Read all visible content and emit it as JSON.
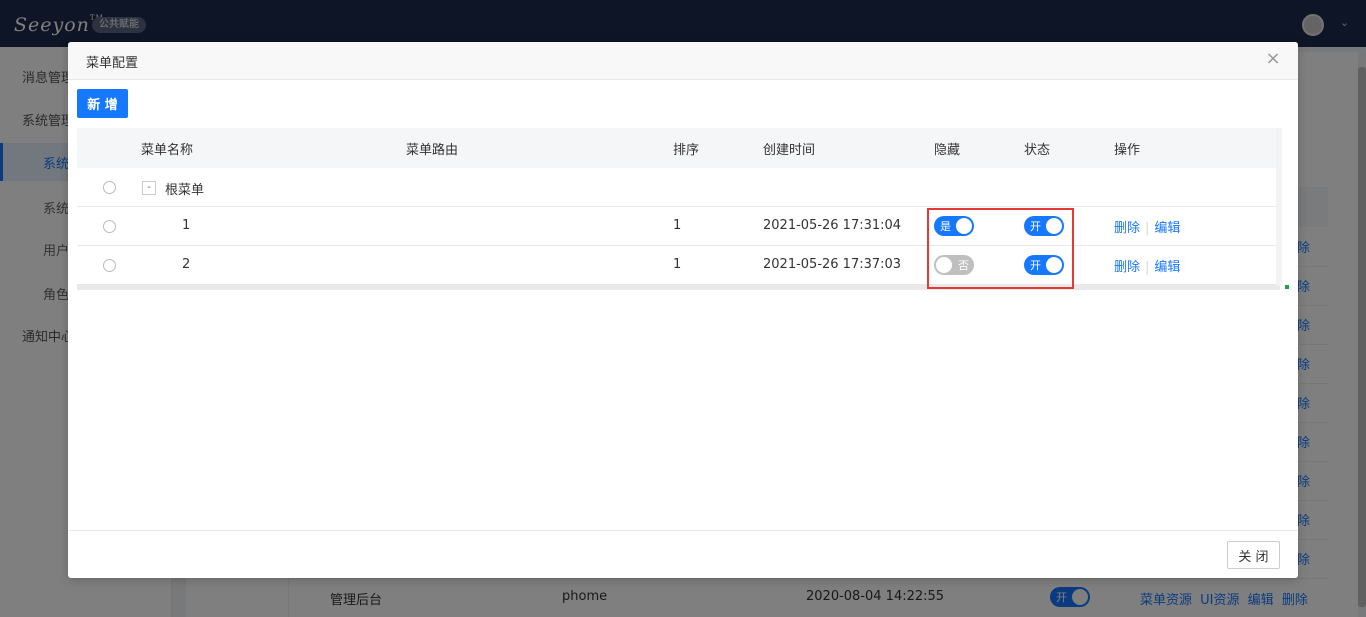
{
  "app": {
    "logo_text": "Seeyon",
    "logo_tm": "TM",
    "badge": "公共赋能"
  },
  "sidebar": {
    "items": [
      "消息管理",
      "系统管理",
      "通知中心"
    ],
    "subitems": [
      "系统",
      "系统",
      "用户",
      "角色"
    ]
  },
  "background_table": {
    "op_fragment": "除",
    "last_row": {
      "name": "管理后台",
      "route": "phome",
      "time": "2020-08-04 14:22:55",
      "toggle_label": "开",
      "ops": [
        "菜单资源",
        "UI资源",
        "编辑",
        "删除"
      ]
    }
  },
  "modal": {
    "title": "菜单配置",
    "close_icon": "×",
    "add_label": "新 增",
    "close_label": "关 闭",
    "columns": {
      "name": "菜单名称",
      "route": "菜单路由",
      "order": "排序",
      "created": "创建时间",
      "hidden": "隐藏",
      "status": "状态",
      "actions": "操作"
    },
    "root": {
      "expander": "-",
      "name": "根菜单"
    },
    "rows": [
      {
        "name": "1",
        "route": "",
        "order": "1",
        "created": "2021-05-26 17:31:04",
        "hidden_label": "是",
        "hidden_on": true,
        "status_label": "开",
        "status_on": true,
        "delete_label": "删除",
        "edit_label": "编辑"
      },
      {
        "name": "2",
        "route": "",
        "order": "1",
        "created": "2021-05-26 17:37:03",
        "hidden_label": "否",
        "hidden_on": false,
        "status_label": "开",
        "status_on": true,
        "delete_label": "删除",
        "edit_label": "编辑"
      }
    ]
  },
  "colors": {
    "primary": "#1677ff",
    "topbar": "#1d2a4d",
    "highlight": "#e53935",
    "toggle_off": "#bfbfbf"
  }
}
